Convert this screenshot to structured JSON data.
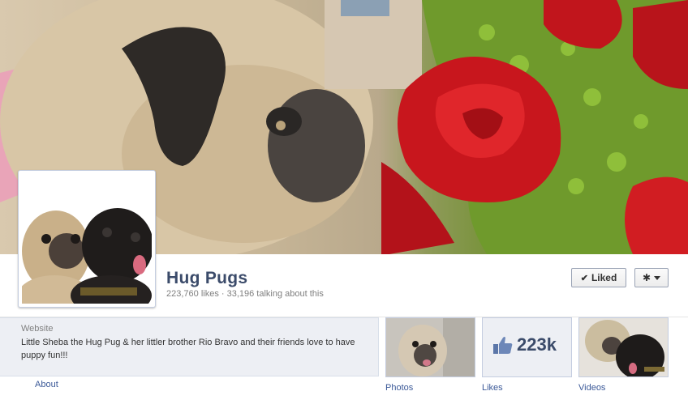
{
  "page": {
    "name": "Hug Pugs",
    "stats": "223,760 likes · 33,196 talking about this"
  },
  "actions": {
    "liked_label": "Liked",
    "liked_icon": "checkmark-icon",
    "settings_icon": "gear-icon"
  },
  "about": {
    "label": "Website",
    "text": "Little Sheba the Hug Pug & her littler brother Rio Bravo and their friends love to have puppy fun!!!",
    "link": "About"
  },
  "tiles": {
    "photos_label": "Photos",
    "likes_label": "Likes",
    "likes_count": "223k",
    "likes_icon": "thumbs-up-icon",
    "videos_label": "Videos"
  },
  "colors": {
    "brand_link": "#3b5998",
    "name_text": "#3b4b6a",
    "panel_bg": "#edeff4"
  }
}
